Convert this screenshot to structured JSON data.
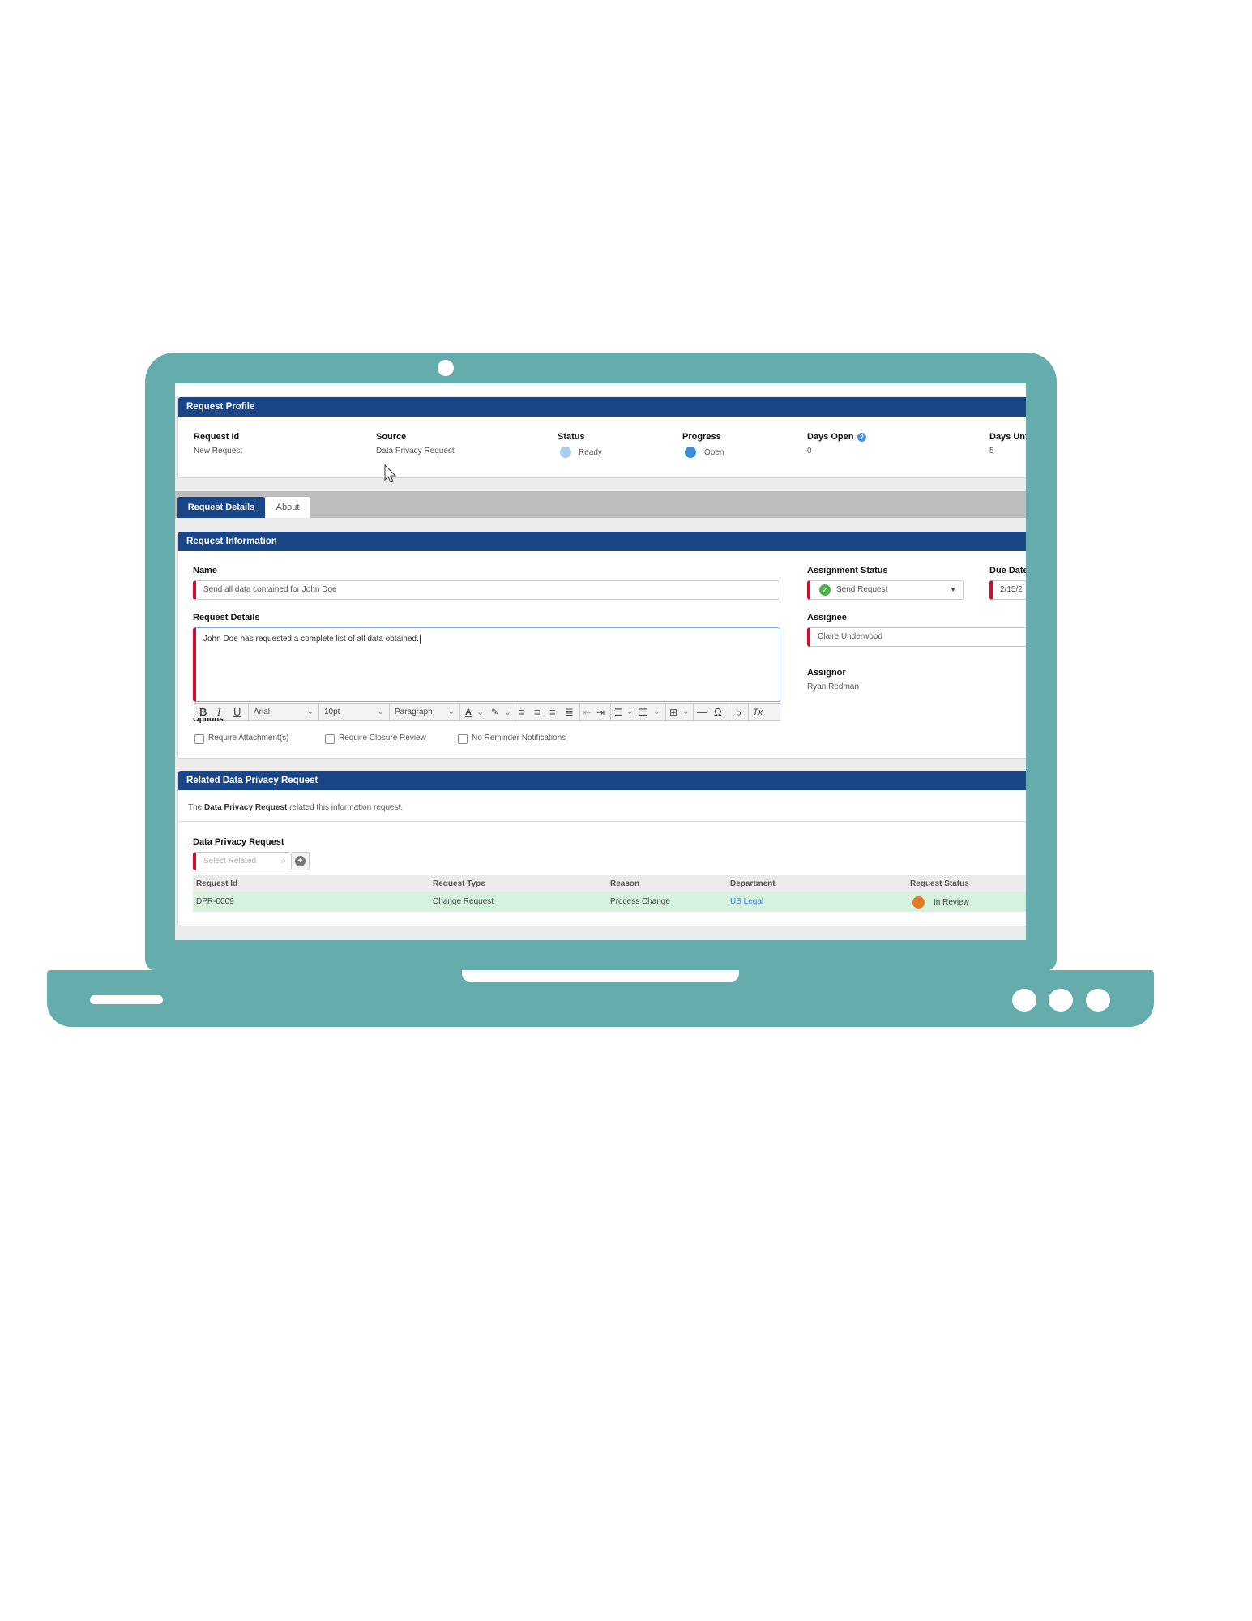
{
  "profile": {
    "title": "Request Profile",
    "fields": [
      {
        "label": "Request Id",
        "value": "New Request"
      },
      {
        "label": "Source",
        "value": "Data Privacy Request"
      },
      {
        "label": "Status",
        "value": "Ready",
        "indicator_color": "#a9cdeb"
      },
      {
        "label": "Progress",
        "value": "Open",
        "indicator_color": "#3b8fd4"
      },
      {
        "label": "Days Open",
        "value": "0",
        "help_icon": "question-circle-icon"
      },
      {
        "label": "Days Unt",
        "value": "5"
      }
    ]
  },
  "tabs": [
    {
      "label": "Request Details",
      "active": true
    },
    {
      "label": "About",
      "active": false
    }
  ],
  "request_info": {
    "title": "Request Information",
    "name_label": "Name",
    "name_value": "Send all data contained for John Doe",
    "details_label": "Request Details",
    "details_value": "John Doe has requested a complete list of all data obtained.",
    "assignment_status_label": "Assignment Status",
    "assignment_status_value": "Send Request",
    "due_date_label": "Due Date",
    "due_date_value": "2/15/2",
    "assignee_label": "Assignee",
    "assignee_value": "Claire Underwood",
    "assignor_label": "Assignor",
    "assignor_value": "Ryan Redman",
    "options_label": "Options",
    "options": [
      {
        "label": "Require Attachment(s)",
        "checked": false
      },
      {
        "label": "Require Closure Review",
        "checked": false
      },
      {
        "label": "No Reminder Notifications",
        "checked": false
      }
    ]
  },
  "editor_toolbar": {
    "bold": "B",
    "italic": "I",
    "underline": "U",
    "font": "Arial",
    "size": "10pt",
    "block": "Paragraph",
    "text_color": "A",
    "omega": "Ω",
    "clear": "Tx"
  },
  "related": {
    "title": "Related Data Privacy Request",
    "description_prefix": "The",
    "description_bold": "Data Privacy Request",
    "description_suffix": "related this information request.",
    "field_label": "Data Privacy Request",
    "select_placeholder": "Select Related",
    "columns": [
      "Request Id",
      "Request Type",
      "Reason",
      "Department",
      "Request Status"
    ],
    "rows": [
      {
        "request_id": "DPR-0009",
        "request_type": "Change Request",
        "reason": "Process Change",
        "department": "US Legal",
        "status": "In Review",
        "status_color": "#e07b28"
      }
    ]
  },
  "colors": {
    "header_blue": "#1a4587",
    "laptop_teal": "#64adac",
    "required_red": "#c8102e",
    "row_green": "#d5f2de",
    "link_blue": "#3b7dd8",
    "success_green": "#4caf50"
  }
}
